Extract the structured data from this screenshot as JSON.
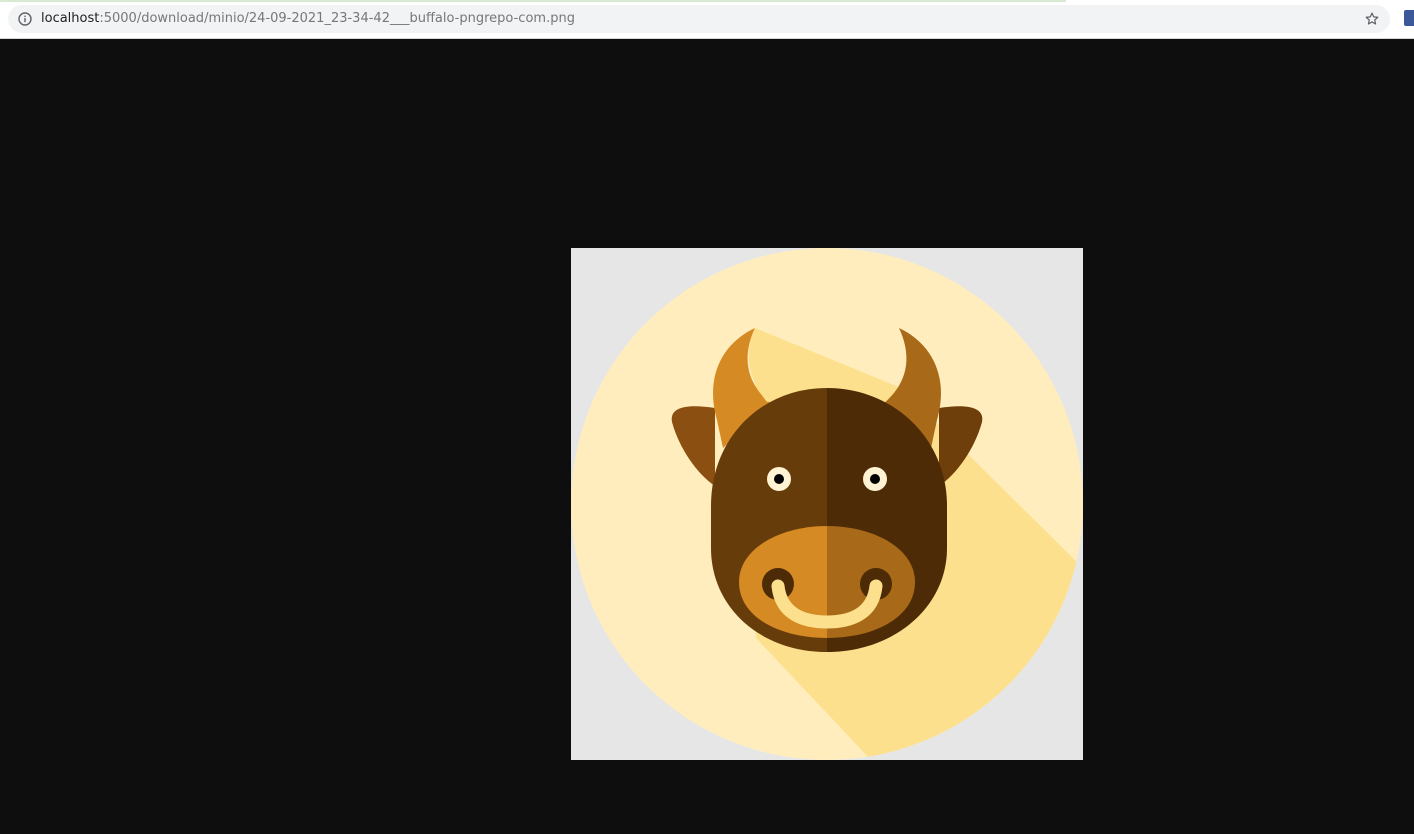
{
  "browser": {
    "url_host": "localhost",
    "url_path": ":5000/download/minio/24-09-2021_23-34-42___buffalo-pngrepo-com.png",
    "info_icon": "info-icon",
    "bookmark_icon": "star-icon"
  },
  "viewer": {
    "background_color": "#0e0e0e",
    "image": {
      "icon": "buffalo-face-illustration",
      "colors": {
        "frame": "#e6e6e6",
        "circle": "#ffedbd",
        "shadow": "#fde08e",
        "head_left": "#673c0b",
        "head_right": "#4c2b06",
        "horn_left": "#d58a23",
        "horn_right": "#a86918",
        "muzzle_left": "#d58a23",
        "muzzle_right": "#a86918",
        "ring": "#fde08e",
        "eye": "#fff3d3"
      }
    }
  }
}
